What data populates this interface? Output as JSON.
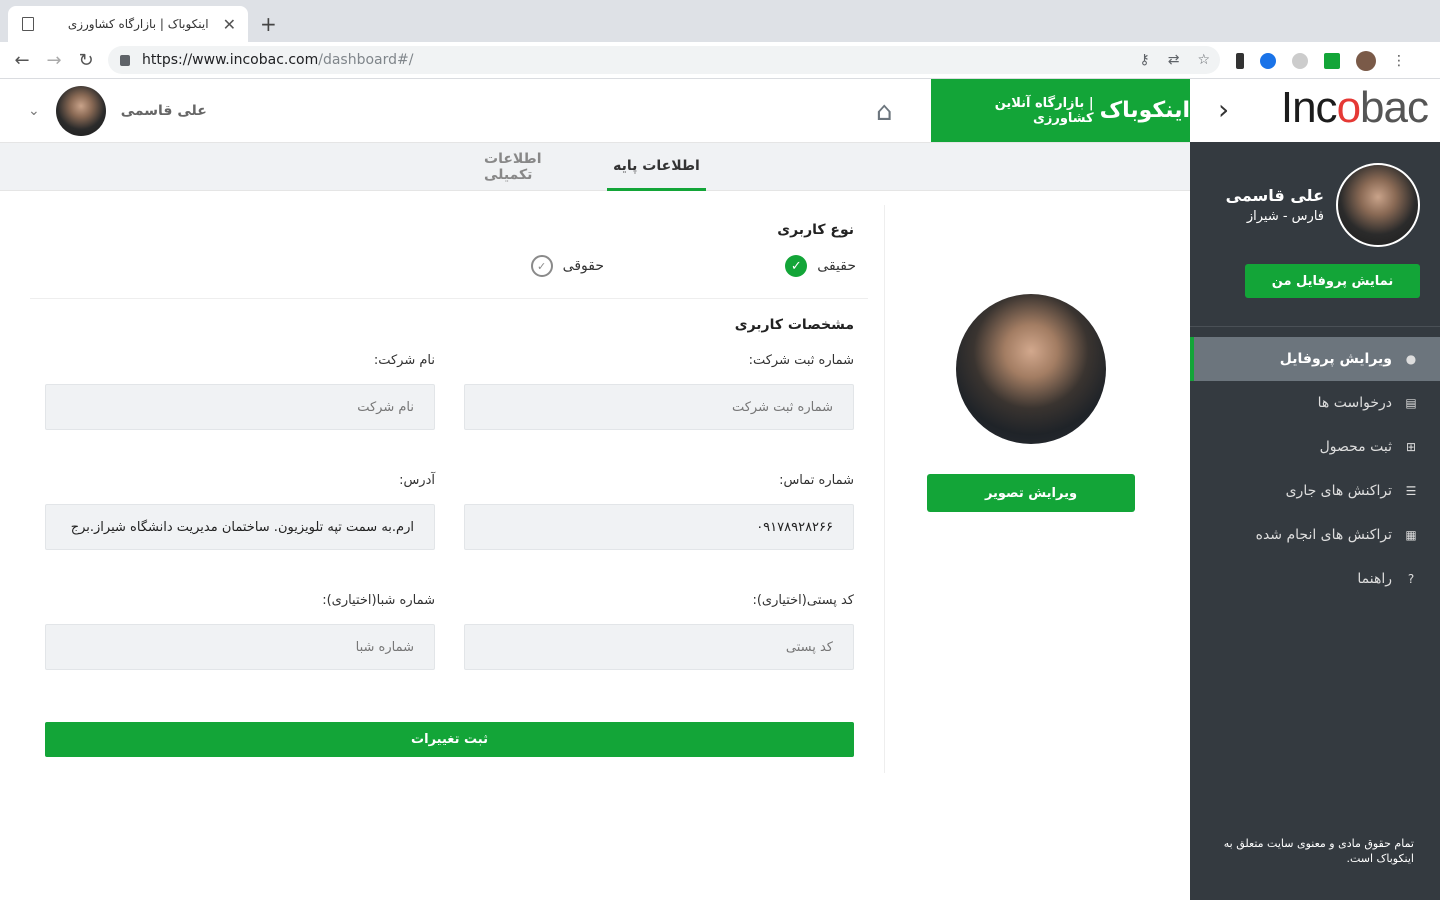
{
  "browser": {
    "tab_title": "اینکوباک | بازارگاه کشاورزی",
    "url_host": "https://www.incobac.com",
    "url_path": "/dashboard#/"
  },
  "sidebar": {
    "logo": {
      "part1": "Inc",
      "part2": "o",
      "part3": "bac"
    },
    "user_name": "علی قاسمی",
    "user_location": "فارس - شیراز",
    "profile_button": "نمایش پروفایل من",
    "menu": [
      {
        "label": "ویرایش پروفایل",
        "icon": "user-icon",
        "active": true
      },
      {
        "label": "درخواست ها",
        "icon": "list-card-icon",
        "active": false
      },
      {
        "label": "ثبت محصول",
        "icon": "plus-square-icon",
        "active": false
      },
      {
        "label": "تراکنش های جاری",
        "icon": "list-icon",
        "active": false
      },
      {
        "label": "تراکنش های انجام شده",
        "icon": "table-icon",
        "active": false
      },
      {
        "label": "راهنما",
        "icon": "help-icon",
        "active": false
      }
    ],
    "copyright": "تمام حقوق مادی و معنوی سایت متعلق به اینکوباک است."
  },
  "header": {
    "brand_big": "اینکوباک",
    "brand_small": "| بازارگاه آنلاین کشاورزی",
    "user_name": "علی قاسمی"
  },
  "tabs": {
    "basic": "اطلاعات پایه",
    "extra": "اطلاعات تکمیلی"
  },
  "profile": {
    "edit_image": "ویرایش تصویر"
  },
  "form": {
    "user_type_title": "نوع کاربری",
    "real_label": "حقیقی",
    "legal_label": "حقوقی",
    "section_title": "مشخصات کاربری",
    "company_reg": {
      "label": "شماره ثبت شرکت:",
      "placeholder": "شماره ثبت شرکت"
    },
    "company_name": {
      "label": "نام شرکت:",
      "placeholder": "نام شرکت"
    },
    "phone": {
      "label": "شماره تماس:",
      "value": "۰۹۱۷۸۹۲۸۲۶۶"
    },
    "address": {
      "label": "آدرس:",
      "value": "ارم.به سمت تپه تلویزیون. ساختمان مدیریت دانشگاه شیراز.برج"
    },
    "postal": {
      "label": "کد پستی(اختیاری):",
      "placeholder": "کد پستی"
    },
    "sheba": {
      "label": "شماره شبا(اختیاری):",
      "placeholder": "شماره شبا"
    },
    "submit": "ثبت تغییرات"
  },
  "colors": {
    "accent": "#13a538",
    "sidebar": "#343a40"
  }
}
